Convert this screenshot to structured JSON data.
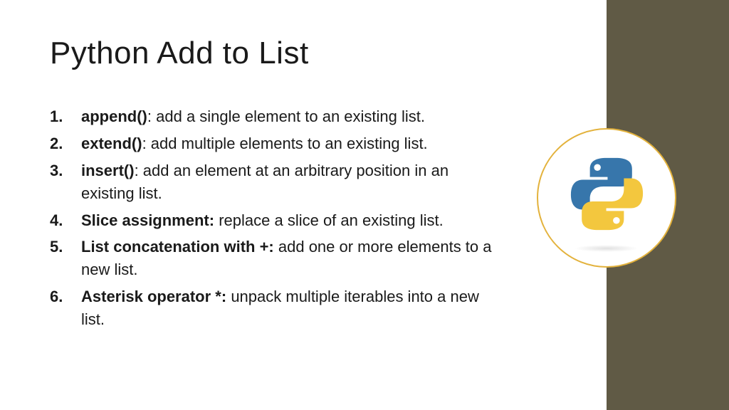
{
  "title": "Python Add to List",
  "items": [
    {
      "term": "append()",
      "colon": ": ",
      "desc": "add a single element to an existing list."
    },
    {
      "term": "extend()",
      "colon": ": ",
      "desc": "add multiple elements to an existing list."
    },
    {
      "term": "insert()",
      "colon": ": ",
      "desc": "add an element at an arbitrary position in an existing list."
    },
    {
      "term": "Slice assignment:",
      "colon": " ",
      "desc": "replace a slice of an existing list."
    },
    {
      "term": "List concatenation with +:",
      "colon": " ",
      "desc": "add one or more elements to a new list."
    },
    {
      "term": "Asterisk operator *:",
      "colon": " ",
      "desc": "unpack multiple iterables into a new list."
    }
  ],
  "logo_name": "python-logo",
  "colors": {
    "sidebar": "#605a45",
    "badge_border": "#e3b23c",
    "python_blue": "#3776ab",
    "python_yellow": "#f3c73e"
  }
}
